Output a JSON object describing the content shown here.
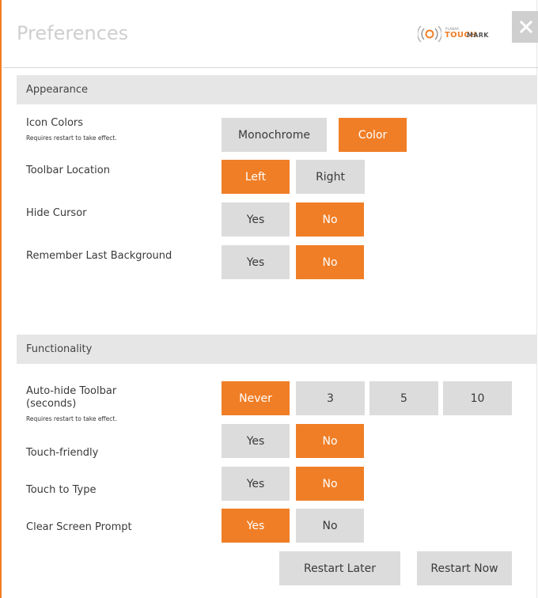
{
  "window": {
    "title": "Preferences",
    "logo": {
      "small_text": "PLANAR",
      "brand_touch": "TOUCH",
      "brand_mark": "MARK"
    },
    "close_icon": "close-icon"
  },
  "colors": {
    "accent": "#f07e26",
    "option_off": "#dcdcdc",
    "section_bg": "#e6e6e6"
  },
  "appearance": {
    "header": "Appearance",
    "icon_colors": {
      "label": "Icon Colors",
      "sub": "Requires restart to take effect.",
      "options": [
        "Monochrome",
        "Color"
      ],
      "selected": "Color"
    },
    "toolbar_location": {
      "label": "Toolbar Location",
      "options": [
        "Left",
        "Right"
      ],
      "selected": "Left"
    },
    "hide_cursor": {
      "label": "Hide Cursor",
      "options": [
        "Yes",
        "No"
      ],
      "selected": "No"
    },
    "remember_background": {
      "label": "Remember Last Background",
      "options": [
        "Yes",
        "No"
      ],
      "selected": "No"
    }
  },
  "functionality": {
    "header": "Functionality",
    "auto_hide": {
      "label": "Auto-hide Toolbar",
      "label_line2": "(seconds)",
      "sub": "Requires restart to take effect.",
      "options": [
        "Never",
        "3",
        "5",
        "10"
      ],
      "selected": "Never"
    },
    "touch_friendly": {
      "label": "Touch-friendly",
      "options": [
        "Yes",
        "No"
      ],
      "selected": "No"
    },
    "touch_to_type": {
      "label": "Touch to Type",
      "options": [
        "Yes",
        "No"
      ],
      "selected": "No"
    },
    "clear_screen": {
      "label": "Clear Screen Prompt",
      "options": [
        "Yes",
        "No"
      ],
      "selected": "Yes"
    }
  },
  "footer": {
    "restart_later": "Restart Later",
    "restart_now": "Restart Now"
  }
}
